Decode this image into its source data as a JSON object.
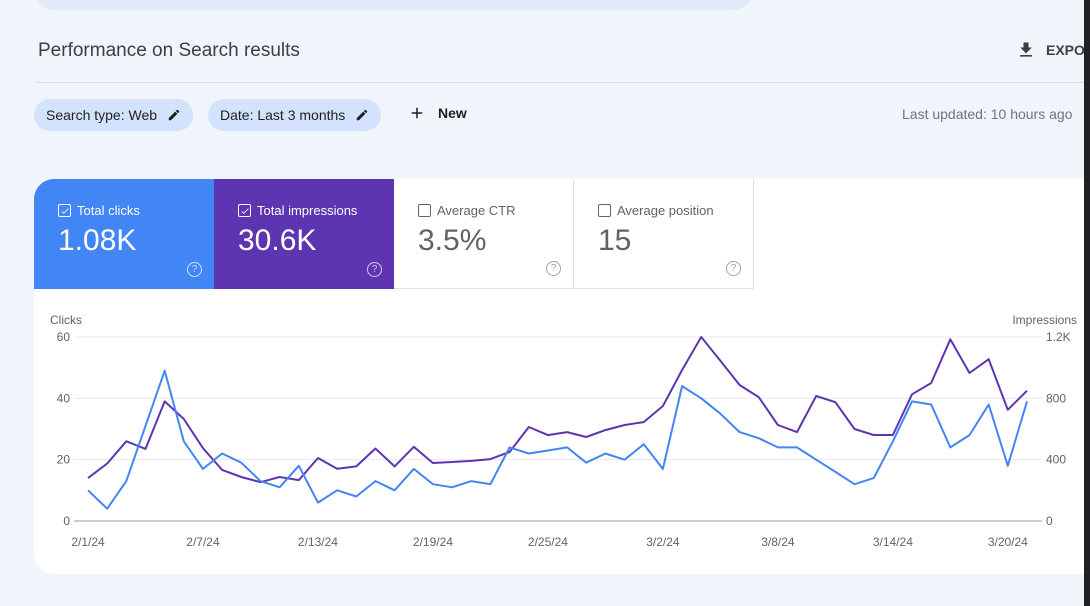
{
  "header": {
    "title": "Performance on Search results",
    "export_label": "EXPORT",
    "export_icon": "download-icon"
  },
  "filters": {
    "chips": [
      {
        "label": "Search type: Web",
        "icon": "edit-icon"
      },
      {
        "label": "Date: Last 3 months",
        "icon": "edit-icon"
      }
    ],
    "new_label": "New",
    "new_icon": "plus-icon",
    "last_updated": "Last updated: 10 hours ago"
  },
  "metrics": [
    {
      "label": "Total clicks",
      "value": "1.08K",
      "checked": true,
      "color": "#4285f4"
    },
    {
      "label": "Total impressions",
      "value": "30.6K",
      "checked": true,
      "color": "#5e35b1"
    },
    {
      "label": "Average CTR",
      "value": "3.5%",
      "checked": false
    },
    {
      "label": "Average position",
      "value": "15",
      "checked": false
    }
  ],
  "chart_data": {
    "type": "line",
    "title": "",
    "ylabel": "Clicks",
    "ylabel_right": "Impressions",
    "ylim": [
      0,
      60
    ],
    "ylim_right": [
      0,
      1200
    ],
    "yticks": [
      "0",
      "20",
      "40",
      "60"
    ],
    "yticks_right": [
      "0",
      "400",
      "800",
      "1.2K"
    ],
    "grid": true,
    "xtick_labels": [
      "2/1/24",
      "2/7/24",
      "2/13/24",
      "2/19/24",
      "2/25/24",
      "3/2/24",
      "3/8/24",
      "3/14/24",
      "3/20/24"
    ],
    "x": [
      "2/1/24",
      "2/2/24",
      "2/3/24",
      "2/4/24",
      "2/5/24",
      "2/6/24",
      "2/7/24",
      "2/8/24",
      "2/9/24",
      "2/10/24",
      "2/11/24",
      "2/12/24",
      "2/13/24",
      "2/14/24",
      "2/15/24",
      "2/16/24",
      "2/17/24",
      "2/18/24",
      "2/19/24",
      "2/20/24",
      "2/21/24",
      "2/22/24",
      "2/23/24",
      "2/24/24",
      "2/25/24",
      "2/26/24",
      "2/27/24",
      "2/28/24",
      "2/29/24",
      "3/1/24",
      "3/2/24",
      "3/3/24",
      "3/4/24",
      "3/5/24",
      "3/6/24",
      "3/7/24",
      "3/8/24",
      "3/9/24",
      "3/10/24",
      "3/11/24",
      "3/12/24",
      "3/13/24",
      "3/14/24",
      "3/15/24",
      "3/16/24",
      "3/17/24",
      "3/18/24",
      "3/19/24",
      "3/20/24",
      "3/21/24"
    ],
    "series": [
      {
        "name": "Clicks",
        "axis": "left",
        "color": "#4285f4",
        "values": [
          10,
          4,
          13,
          31,
          49,
          26,
          17,
          22,
          19,
          13,
          11,
          18,
          6,
          10,
          8,
          13,
          10,
          17,
          12,
          11,
          13,
          12,
          24,
          22,
          23,
          24,
          19,
          22,
          20,
          25,
          17,
          44,
          40,
          35,
          29,
          27,
          24,
          24,
          20,
          16,
          12,
          14,
          26,
          39,
          38,
          24,
          28,
          38,
          18,
          39
        ]
      },
      {
        "name": "Impressions",
        "axis": "right",
        "color": "#5e35b1",
        "values": [
          280,
          375,
          520,
          470,
          780,
          665,
          475,
          333,
          287,
          253,
          287,
          267,
          411,
          341,
          356,
          473,
          356,
          484,
          378,
          385,
          392,
          404,
          450,
          613,
          560,
          580,
          548,
          593,
          626,
          645,
          750,
          985,
          1200,
          1045,
          887,
          808,
          626,
          580,
          815,
          775,
          600,
          561,
          561,
          826,
          900,
          1185,
          965,
          1055,
          725,
          850
        ]
      }
    ]
  }
}
